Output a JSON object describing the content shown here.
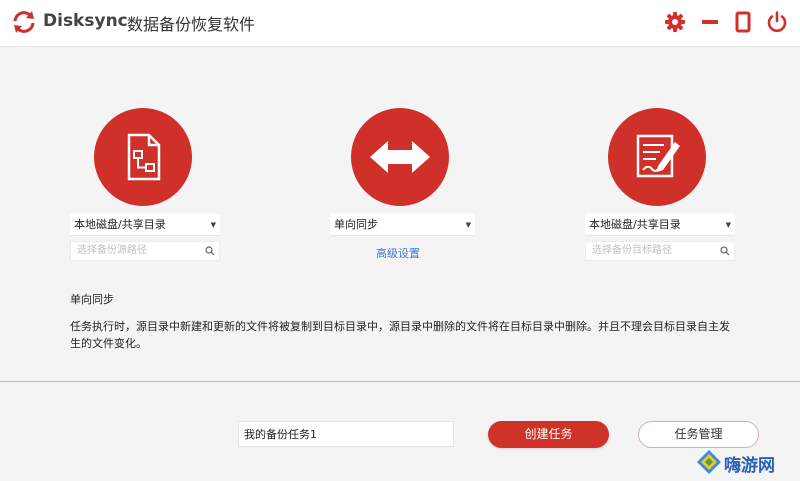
{
  "header": {
    "brand": "Disksync",
    "title": "数据备份恢复软件",
    "icons": [
      "sync-logo-icon",
      "gear-icon",
      "minimize-icon",
      "maximize-icon",
      "power-icon"
    ]
  },
  "source": {
    "icon": "document-icon",
    "select_value": "本地磁盘/共享目录",
    "path_placeholder": "选择备份源路径"
  },
  "mode": {
    "icon": "double-arrow-icon",
    "select_value": "单向同步",
    "advanced_link": "高级设置"
  },
  "target": {
    "icon": "pencil-note-icon",
    "select_value": "本地磁盘/共享目录",
    "path_placeholder": "选择备份目标路径"
  },
  "description": {
    "title": "单向同步",
    "text": "任务执行时，源目录中新建和更新的文件将被复制到目标目录中，源目录中删除的文件将在目标目录中删除。并且不理会目标目录自主发生的文件变化。"
  },
  "footer": {
    "task_name": "我的备份任务1",
    "create_button": "创建任务",
    "manage_button": "任务管理"
  },
  "watermark": {
    "text": "嗨游网"
  },
  "colors": {
    "accent": "#d0302a",
    "link": "#3a7bd5"
  }
}
